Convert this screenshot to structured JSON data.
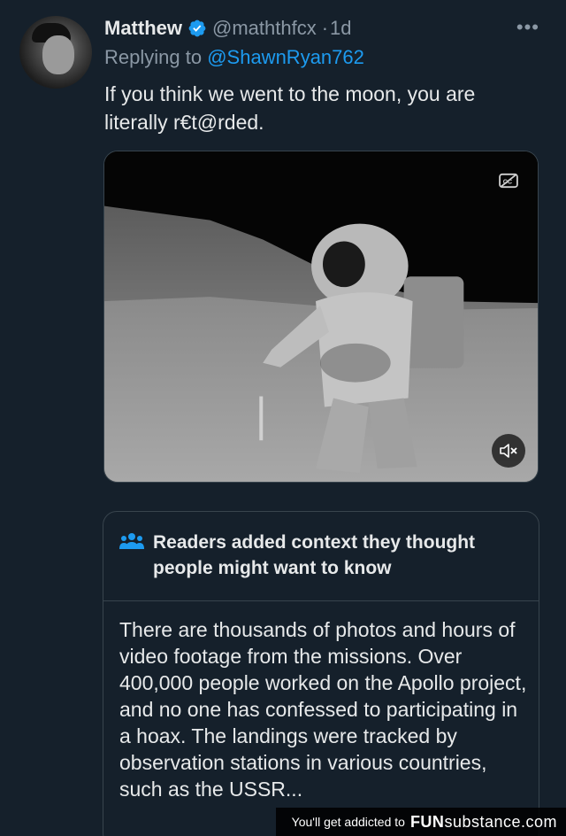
{
  "author": {
    "name": "Matthew",
    "handle": "@maththfcx",
    "separator": "·",
    "time": "1d"
  },
  "reply": {
    "prefix": "Replying to",
    "mention": "@ShawnRyan762"
  },
  "tweet": {
    "text": "If you think we went to the moon, you are literally r€t@rded."
  },
  "media": {
    "type": "video",
    "cc_icon": "closed-captions-off-icon",
    "mute_icon": "speaker-muted-icon"
  },
  "community_note": {
    "icon": "people-icon",
    "title": "Readers added context they thought people might want to know",
    "body": "There are thousands of photos and hours of video footage from the missions. Over 400,000 people worked on the Apollo project, and no one has confessed to participating in a hoax. The landings were tracked by observation stations in various countries, such as the USSR..."
  },
  "watermark": {
    "text": "You'll get addicted to",
    "brand_bold": "FUN",
    "brand_rest": "substance.com"
  },
  "colors": {
    "background": "#15202b",
    "accent": "#1d9bf0",
    "secondary_text": "#8b98a5",
    "border": "#38444d"
  }
}
